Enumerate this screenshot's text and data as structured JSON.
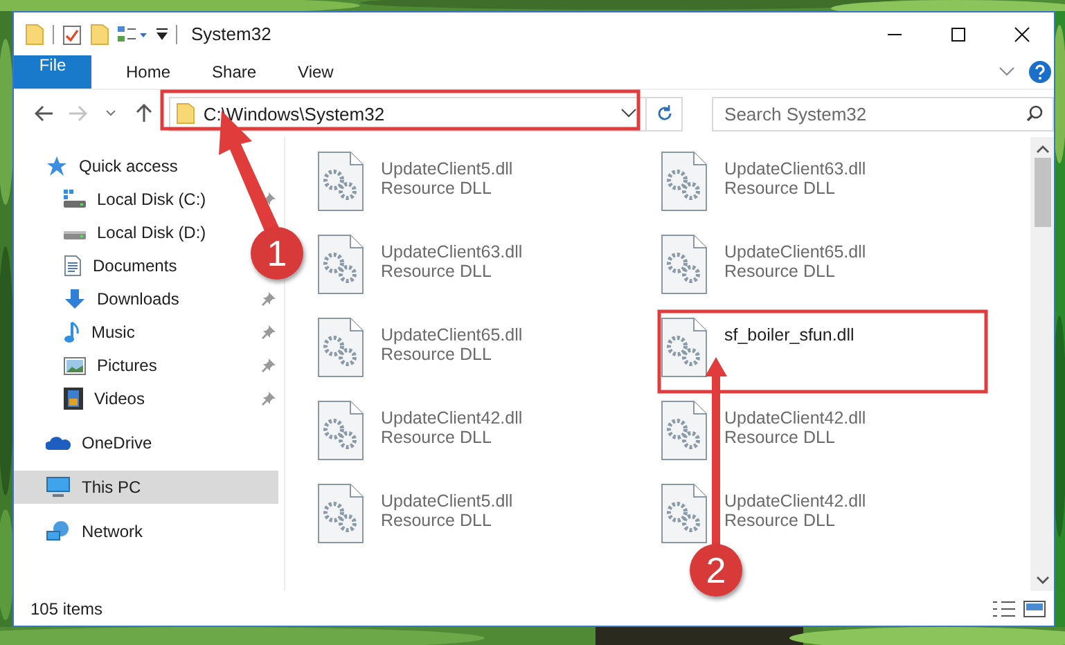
{
  "window": {
    "title": "System32"
  },
  "ribbon": {
    "tabs": [
      {
        "label": "File",
        "kind": "file"
      },
      {
        "label": "Home",
        "kind": "tab"
      },
      {
        "label": "Share",
        "kind": "tab"
      },
      {
        "label": "View",
        "kind": "tab"
      }
    ]
  },
  "address_bar": {
    "path": "C:\\Windows\\System32"
  },
  "search": {
    "placeholder": "Search System32"
  },
  "sidebar": {
    "items": [
      {
        "label": "Quick access",
        "kind": "star",
        "selected": false,
        "children": [
          {
            "label": "Local Disk (C:)",
            "kind": "system-drive",
            "pinned": true,
            "selected": false
          },
          {
            "label": "Local Disk (D:)",
            "kind": "drive",
            "pinned": false,
            "selected": false
          },
          {
            "label": "Documents",
            "kind": "documents",
            "pinned": false,
            "selected": false
          },
          {
            "label": "Downloads",
            "kind": "downloads",
            "pinned": true,
            "selected": false
          },
          {
            "label": "Music",
            "kind": "music",
            "pinned": true,
            "selected": false
          },
          {
            "label": "Pictures",
            "kind": "pictures",
            "pinned": true,
            "selected": false
          },
          {
            "label": "Videos",
            "kind": "videos",
            "pinned": true,
            "selected": false
          }
        ]
      },
      {
        "label": "OneDrive",
        "kind": "cloud",
        "selected": false
      },
      {
        "label": "This PC",
        "kind": "pc",
        "selected": true
      },
      {
        "label": "Network",
        "kind": "network",
        "selected": false
      }
    ]
  },
  "files": [
    {
      "name": "UpdateClient5.dll",
      "type": "Resource DLL",
      "blurred": true
    },
    {
      "name": "UpdateClient63.dll",
      "type": "Resource DLL",
      "blurred": true
    },
    {
      "name": "UpdateClient63.dll",
      "type": "Resource DLL",
      "blurred": true
    },
    {
      "name": "UpdateClient65.dll",
      "type": "Resource DLL",
      "blurred": true
    },
    {
      "name": "UpdateClient65.dll",
      "type": "Resource DLL",
      "blurred": true
    },
    {
      "name": "sf_boiler_sfun.dll",
      "blurred": false
    },
    {
      "name": "UpdateClient42.dll",
      "type": "Resource DLL",
      "blurred": true
    },
    {
      "name": "UpdateClient42.dll",
      "type": "Resource DLL",
      "blurred": true
    },
    {
      "name": "UpdateClient5.dll",
      "type": "Resource DLL",
      "blurred": true
    },
    {
      "name": "UpdateClient42.dll",
      "type": "Resource DLL",
      "blurred": true
    }
  ],
  "status_bar": {
    "count": "105 items"
  },
  "annotations": [
    {
      "number": "1"
    },
    {
      "number": "2"
    }
  ]
}
